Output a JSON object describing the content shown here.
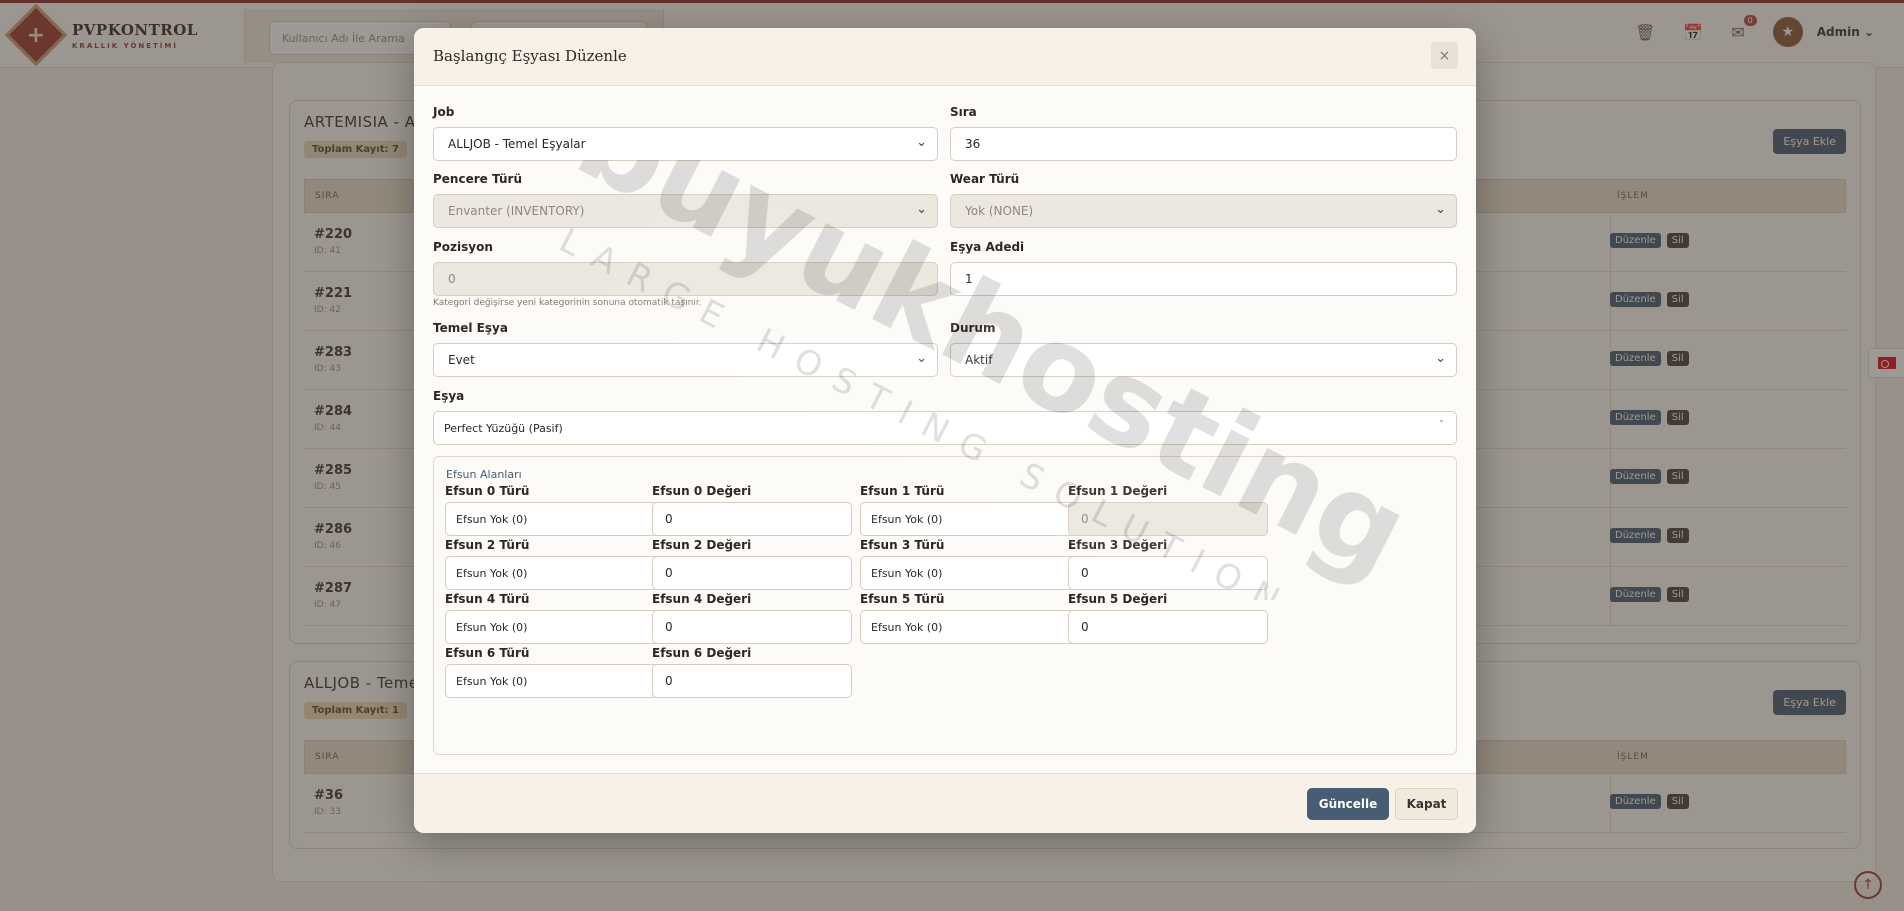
{
  "brand": {
    "name": "PVPKONTROL",
    "subtitle": "KRALLIK YÖNETİMİ"
  },
  "topbar": {
    "search_placeholder": "Kullanıcı Adı İle Arama",
    "notification_count": "0",
    "user_name": "Admin"
  },
  "sections": [
    {
      "title": "ARTEMISIA - Ar",
      "count": "Toplam Kayıt: 7",
      "add_label": "Eşya Ekle",
      "col_order": "SIRA",
      "col_action": "İŞLEM",
      "rows": [
        {
          "id": "#220",
          "sub": "ID: 41"
        },
        {
          "id": "#221",
          "sub": "ID: 42"
        },
        {
          "id": "#283",
          "sub": "ID: 43"
        },
        {
          "id": "#284",
          "sub": "ID: 44"
        },
        {
          "id": "#285",
          "sub": "ID: 45"
        },
        {
          "id": "#286",
          "sub": "ID: 46"
        },
        {
          "id": "#287",
          "sub": "ID: 47"
        }
      ]
    },
    {
      "title": "ALLJOB - Temel",
      "count": "Toplam Kayıt: 1",
      "add_label": "Eşya Ekle",
      "col_order": "SIRA",
      "col_action": "İŞLEM",
      "rows": [
        {
          "id": "#36",
          "sub": "ID: 33"
        }
      ]
    }
  ],
  "row_actions": {
    "edit": "Düzenle",
    "delete": "Sil"
  },
  "modal": {
    "title": "Başlangıç Eşyası Düzenle",
    "fields": {
      "job": {
        "label": "Job",
        "value": "ALLJOB - Temel Eşyalar"
      },
      "order": {
        "label": "Sıra",
        "value": "36"
      },
      "window_type": {
        "label": "Pencere Türü",
        "value": "Envanter (INVENTORY)"
      },
      "wear_type": {
        "label": "Wear Türü",
        "value": "Yok (NONE)"
      },
      "position": {
        "label": "Pozisyon",
        "value": "0",
        "hint": "Kategori değişirse yeni kategorinin sonuna otomatik taşınır."
      },
      "item_count": {
        "label": "Eşya Adedi",
        "value": "1"
      },
      "basic_item": {
        "label": "Temel Eşya",
        "value": "Evet"
      },
      "status": {
        "label": "Durum",
        "value": "Aktif"
      },
      "item": {
        "label": "Eşya",
        "value": "Perfect Yüzüğü (Pasif)"
      }
    },
    "efsun": {
      "title": "Efsun Alanları",
      "slots": [
        {
          "type_label": "Efsun 0 Türü",
          "type_value": "Efsun Yok (0)",
          "val_label": "Efsun 0 Değeri",
          "val_value": "0"
        },
        {
          "type_label": "Efsun 1 Türü",
          "type_value": "Efsun Yok (0)",
          "val_label": "Efsun 1 Değeri",
          "val_value": "0"
        },
        {
          "type_label": "Efsun 2 Türü",
          "type_value": "Efsun Yok (0)",
          "val_label": "Efsun 2 Değeri",
          "val_value": "0"
        },
        {
          "type_label": "Efsun 3 Türü",
          "type_value": "Efsun Yok (0)",
          "val_label": "Efsun 3 Değeri",
          "val_value": "0"
        },
        {
          "type_label": "Efsun 4 Türü",
          "type_value": "Efsun Yok (0)",
          "val_label": "Efsun 4 Değeri",
          "val_value": "0"
        },
        {
          "type_label": "Efsun 5 Türü",
          "type_value": "Efsun Yok (0)",
          "val_label": "Efsun 5 Değeri",
          "val_value": "0"
        },
        {
          "type_label": "Efsun 6 Türü",
          "type_value": "Efsun Yok (0)",
          "val_label": "Efsun 6 Değeri",
          "val_value": "0"
        }
      ]
    },
    "buttons": {
      "update": "Güncelle",
      "close": "Kapat"
    }
  },
  "watermark": {
    "main": "buyukhosting",
    "sub": "LARGE HOSTING SOLUTIONS"
  },
  "colors": {
    "accent": "#465d73",
    "brand": "#9b3a30",
    "badge": "#eadbb9"
  }
}
